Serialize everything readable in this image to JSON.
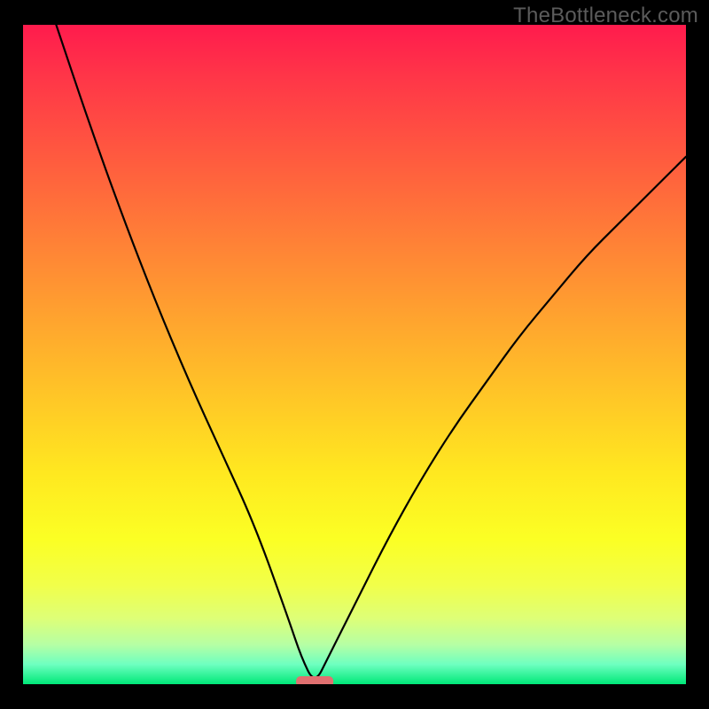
{
  "watermark": {
    "text": "TheBottleneck.com"
  },
  "chart_data": {
    "type": "line",
    "title": "",
    "xlabel": "",
    "ylabel": "",
    "xlim": [
      0,
      100
    ],
    "ylim": [
      0,
      100
    ],
    "grid": false,
    "legend": false,
    "background": "vertical-gradient red→green (bottleneck heatmap)",
    "series": [
      {
        "name": "bottleneck-curve",
        "description": "V-shaped bottleneck curve; minimum near x≈44",
        "x": [
          5,
          10,
          15,
          20,
          25,
          30,
          35,
          40,
          42,
          44,
          46,
          50,
          55,
          60,
          65,
          70,
          75,
          80,
          85,
          90,
          95,
          100
        ],
        "values": [
          100,
          85,
          71,
          58,
          46,
          35,
          24,
          10,
          4,
          0,
          4,
          12,
          22,
          31,
          39,
          46,
          53,
          59,
          65,
          70,
          75,
          80
        ]
      }
    ],
    "marker": {
      "name": "optimal-point",
      "x": 44,
      "y": 0,
      "shape": "rounded-bar",
      "color": "#e07070"
    },
    "gradient_stops": [
      {
        "pos": 0,
        "color": "#ff1b4d"
      },
      {
        "pos": 20,
        "color": "#ff5a3f"
      },
      {
        "pos": 44,
        "color": "#ffa22f"
      },
      {
        "pos": 68,
        "color": "#ffe820"
      },
      {
        "pos": 85,
        "color": "#f1ff4a"
      },
      {
        "pos": 97,
        "color": "#6effc0"
      },
      {
        "pos": 100,
        "color": "#00e878"
      }
    ]
  }
}
